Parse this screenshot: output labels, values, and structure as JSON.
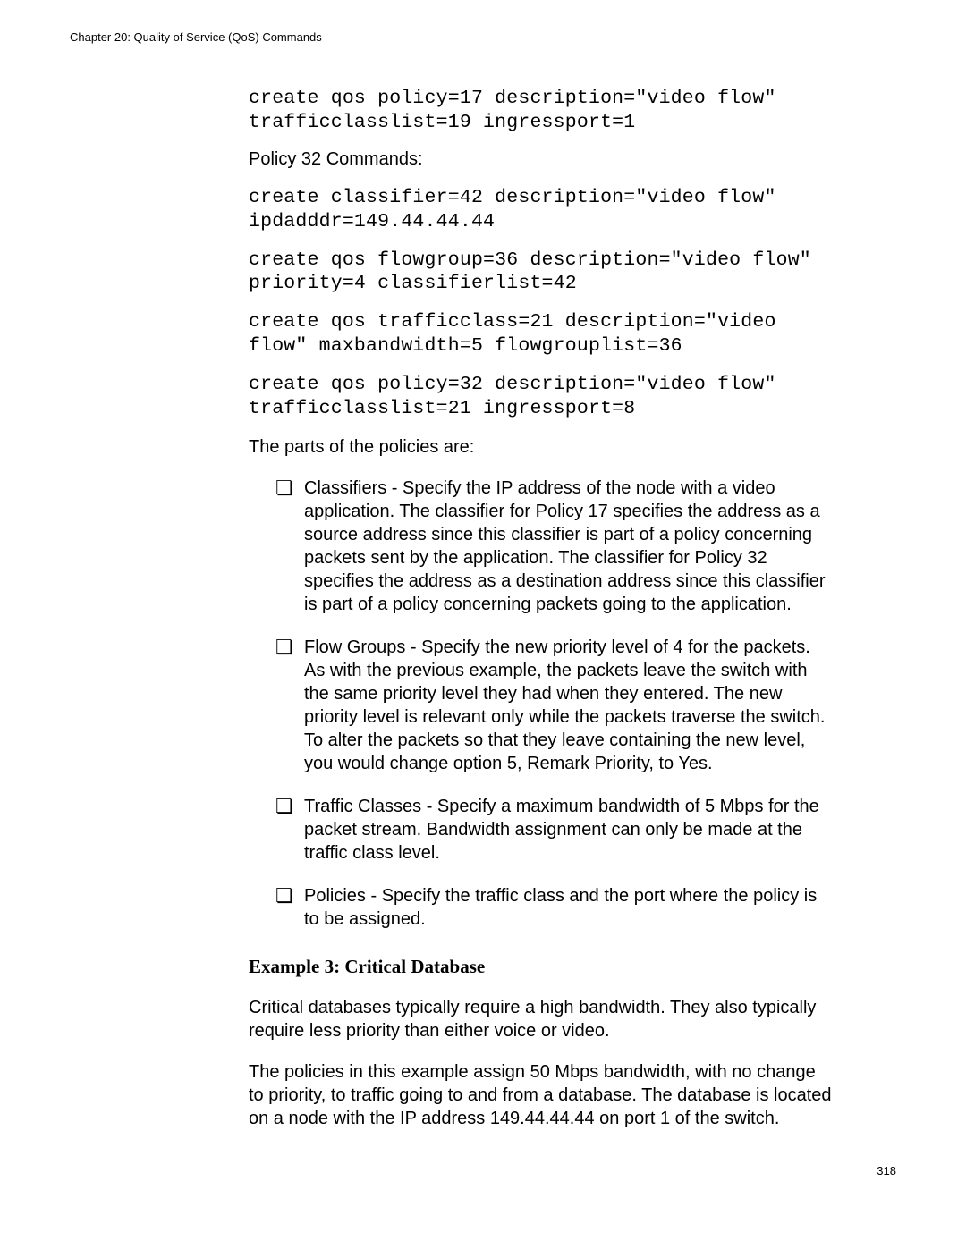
{
  "header": {
    "chapter": "Chapter 20: Quality of Service (QoS) Commands"
  },
  "content": {
    "code1": {
      "line1": "create qos policy=17 description=\"video flow\" trafficclasslist=19 ingressport=1"
    },
    "section_label": "Policy 32 Commands:",
    "code2": {
      "block1": "create classifier=42 description=\"video flow\" ipdadddr=149.44.44.44",
      "block2": "create qos flowgroup=36 description=\"video flow\" priority=4 classifierlist=42",
      "block3": "create qos trafficclass=21 description=\"video flow\" maxbandwidth=5 flowgrouplist=36",
      "block4": "create qos policy=32 description=\"video flow\" trafficclasslist=21 ingressport=8"
    },
    "intro_text": "The parts of the policies are:",
    "bullets": [
      "Classifiers - Specify the IP address of the node with a video application. The classifier for Policy 17 specifies the address as a source address since this classifier is part of a policy concerning packets sent by the application. The classifier for Policy 32 specifies the address as a destination address since this classifier is part of a policy concerning packets going to the application.",
      "Flow Groups - Specify the new priority level of 4 for the packets. As with the previous example, the packets leave the switch with the same priority level they had when they entered. The new priority level is relevant only while the packets traverse the switch. To alter the packets so that they leave containing the new level, you would change option 5, Remark Priority, to Yes.",
      "Traffic Classes - Specify a maximum bandwidth of 5 Mbps for the packet stream. Bandwidth assignment can only be made at the traffic class level.",
      "Policies - Specify the traffic class and the port where the policy is to be assigned."
    ],
    "example_heading": "Example 3: Critical Database",
    "paragraph1": "Critical databases typically require a high bandwidth. They also typically require less priority than either voice or video.",
    "paragraph2": "The policies in this example assign 50 Mbps bandwidth, with no change to priority, to traffic going to and from a database. The database is located on a node with the IP address 149.44.44.44 on port 1 of the switch."
  },
  "footer": {
    "page_number": "318"
  }
}
